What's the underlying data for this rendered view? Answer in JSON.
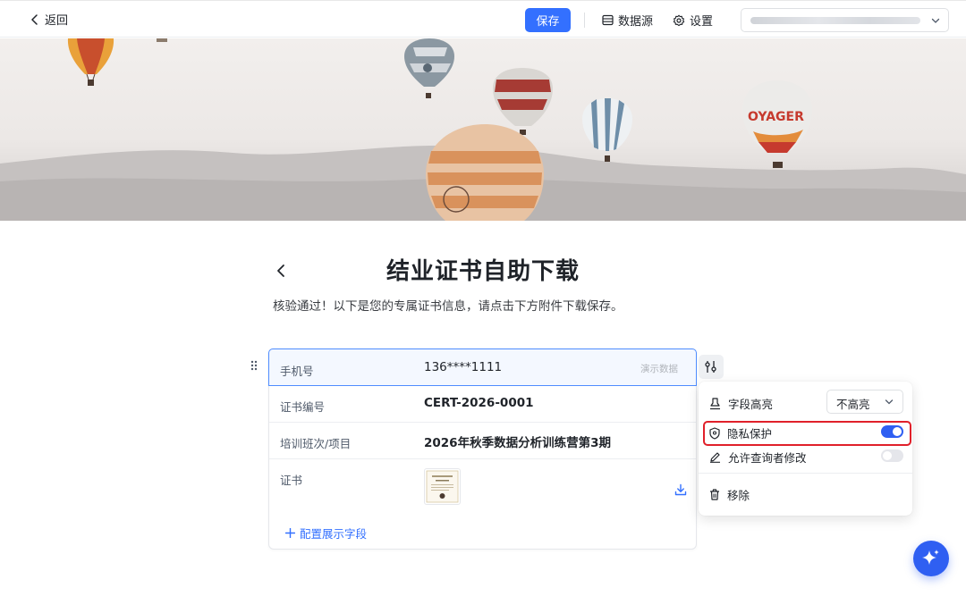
{
  "topbar": {
    "back_label": "返回",
    "save_label": "保存",
    "datasource_label": "数据源",
    "settings_label": "设置"
  },
  "page": {
    "title": "结业证书自助下载",
    "subtitle": "核验通过！以下是您的专属证书信息，请点击下方附件下载保存。"
  },
  "form": {
    "rows": [
      {
        "label": "手机号",
        "value": "136****1111",
        "tag": "演示数据"
      },
      {
        "label": "证书编号",
        "value": "CERT-2026-0001"
      },
      {
        "label": "培训班次/项目",
        "value": "2026年秋季数据分析训练营第3期"
      },
      {
        "label": "证书",
        "value": ""
      }
    ],
    "config_label": "配置展示字段"
  },
  "popover": {
    "highlight_label": "字段高亮",
    "highlight_value": "不高亮",
    "privacy_label": "隐私保护",
    "privacy_on": true,
    "allow_edit_label": "允许查询者修改",
    "allow_edit_on": false,
    "remove_label": "移除"
  },
  "colors": {
    "accent": "#3370ff",
    "fab": "#2f5ff2",
    "highlight_border": "#e0202a"
  }
}
